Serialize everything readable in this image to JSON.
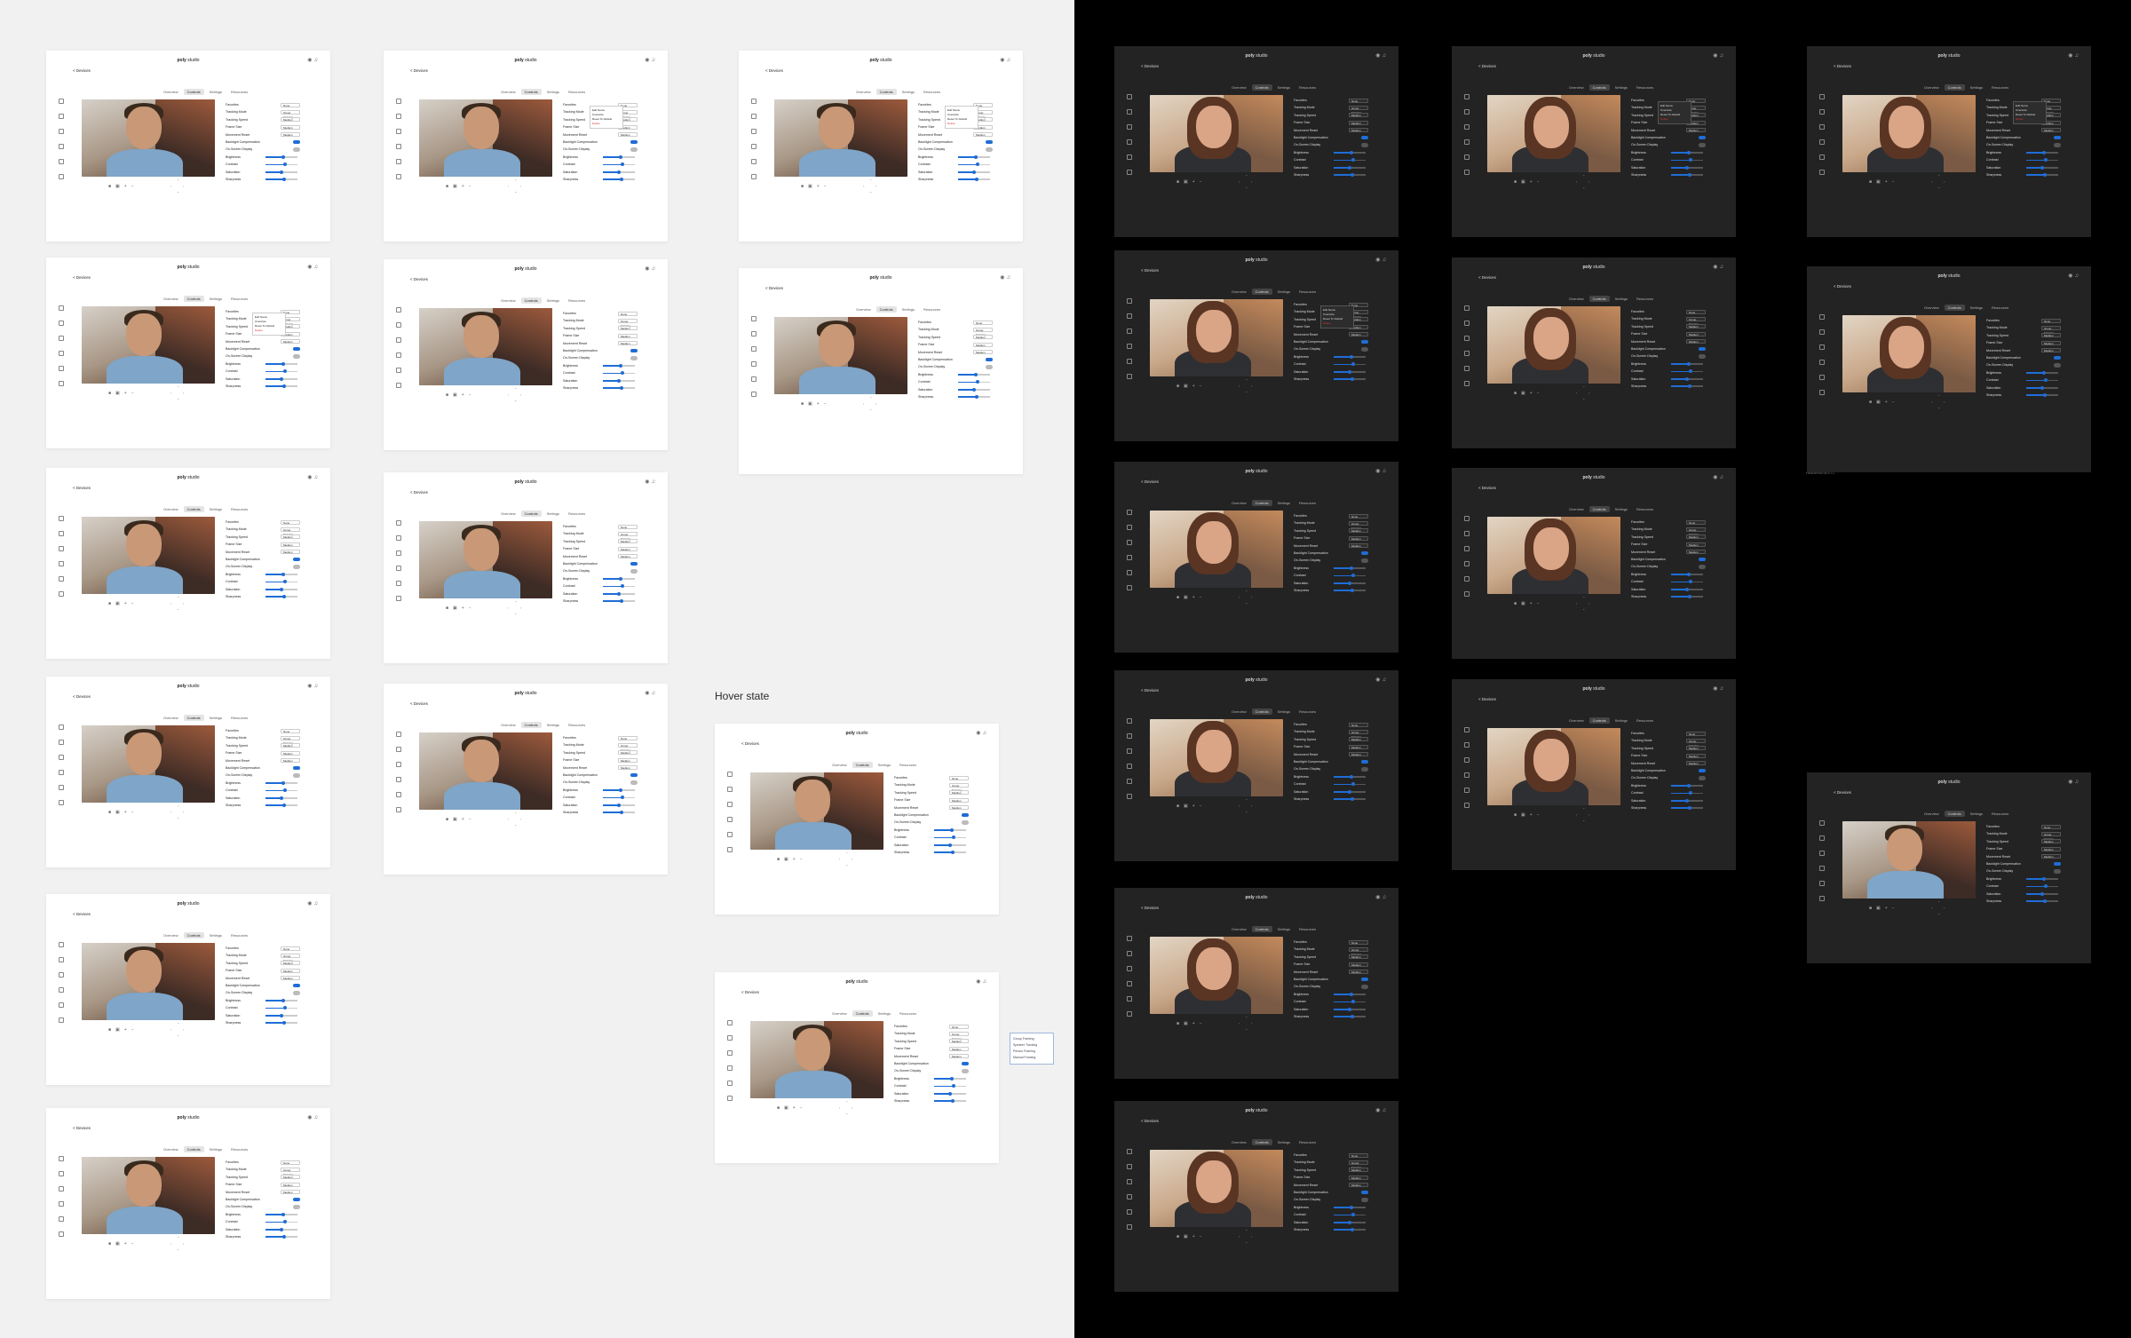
{
  "annotations": {
    "hover_state": "Hover state",
    "footnote_light": "Header/scroll ETC",
    "footnote_dark": "Header/scroll ETC"
  },
  "app": {
    "logo_bold": "poly",
    "logo_rest": " studio",
    "back_label": "< Devices",
    "tabs": [
      "Overview",
      "Controls",
      "Settings",
      "Resources"
    ],
    "active_tab": "Controls",
    "settings": [
      {
        "label": "Favorites",
        "kind": "dropdown",
        "value": "None"
      },
      {
        "label": "Tracking Mode",
        "kind": "dropdown",
        "value": "Group Framing"
      },
      {
        "label": "Tracking Speed",
        "kind": "dropdown",
        "value": "Medium"
      },
      {
        "label": "Frame Size",
        "kind": "dropdown",
        "value": "Medium"
      },
      {
        "label": "Movement Reset",
        "kind": "dropdown",
        "value": "Medium"
      },
      {
        "label": "Backlight Compensation",
        "kind": "toggle",
        "on": true
      },
      {
        "label": "On-Screen Display",
        "kind": "toggle",
        "on": false
      },
      {
        "label": "Brightness",
        "kind": "slider",
        "value": 0.55
      },
      {
        "label": "Contrast",
        "kind": "slider",
        "value": 0.6
      },
      {
        "label": "Saturation",
        "kind": "slider",
        "value": 0.5
      },
      {
        "label": "Sharpness",
        "kind": "slider",
        "value": 0.58
      }
    ],
    "favorites_menu": [
      "Edit Name",
      "Overwrite",
      "Reset To Default",
      "Delete"
    ],
    "tracking_options": [
      "Group Framing",
      "Speaker Tracking",
      "Person Framing",
      "Manual Framing"
    ],
    "camera_controls": [
      "■",
      "▣",
      "+",
      "−"
    ]
  },
  "colors": {
    "accent": "#1f6dd6",
    "light_bg": "#f1f1f1",
    "dark_bg": "#000000"
  },
  "icons": {
    "sidebar": [
      "home-icon",
      "device-icon",
      "calendar-icon",
      "list-icon",
      "grid-icon",
      "settings-icon"
    ],
    "top": [
      "account-icon",
      "bell-icon"
    ]
  }
}
